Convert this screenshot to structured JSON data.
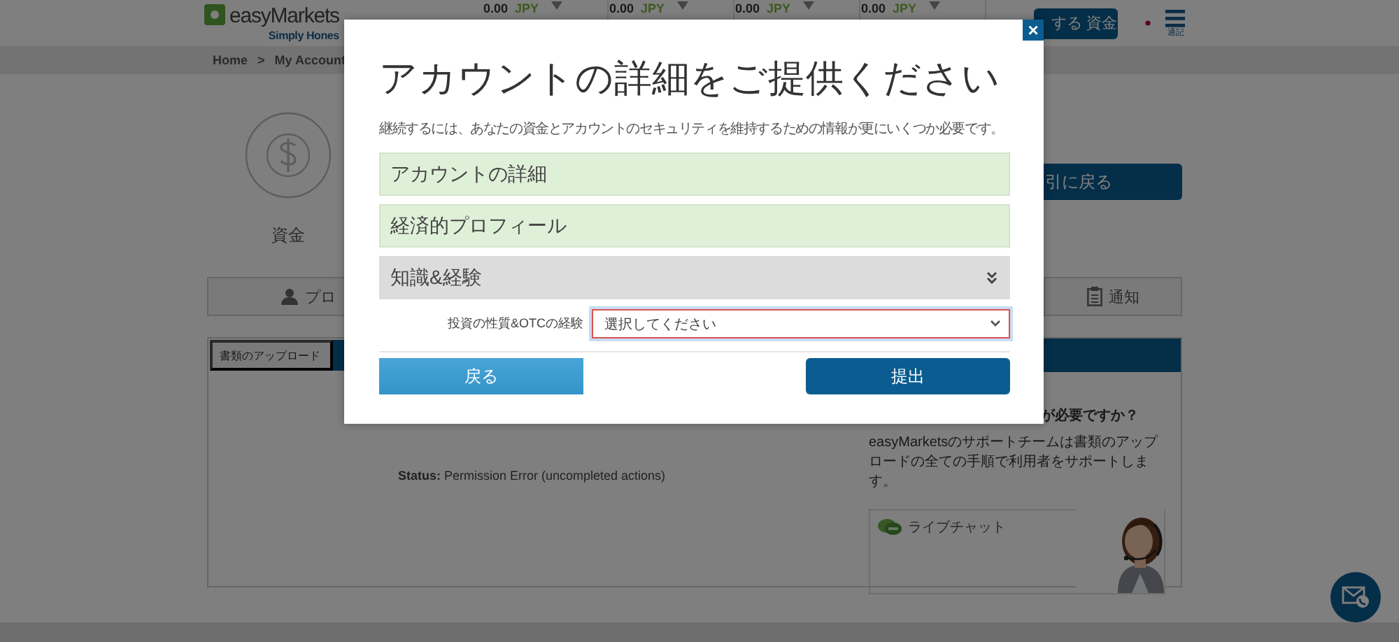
{
  "header": {
    "logo": "easyMarkets",
    "tagline": "Simply Hones",
    "tickers": [
      {
        "price": "0.00",
        "currency": "JPY"
      },
      {
        "price": "0.00",
        "currency": "JPY"
      },
      {
        "price": "0.00",
        "currency": "JPY"
      },
      {
        "price": "0.00",
        "currency": "JPY"
      }
    ],
    "deposit_button": "する 資金",
    "menu_label": "通記"
  },
  "breadcrumb": {
    "items": [
      "Home",
      "My Account"
    ],
    "separator": ">"
  },
  "funds": {
    "label": "資金"
  },
  "back_to_trading_button": "引に戻る",
  "tabs": [
    {
      "label": "プロ"
    },
    {
      "label": "通知"
    }
  ],
  "documents_panel": {
    "tab": "書類のアップロード",
    "status_label": "Status:",
    "status": "Permission Error (uncompleted actions)"
  },
  "support": {
    "heading": "が必要ですか？",
    "text": "easyMarketsのサポートチームは書類のアップロードの全ての手順で利用者をサポートします。",
    "live_chat": "ライブチャット"
  },
  "modal": {
    "close": "×",
    "title": "アカウントの詳細をご提供ください",
    "intro": "継続するには、あなたの資金とアカウントのセキュリティを維持するための情報が更にいくつか必要です。",
    "sections": [
      {
        "label": "アカウントの詳細",
        "completed": true
      },
      {
        "label": "経済的プロフィール",
        "completed": true
      },
      {
        "label": "知識&経験",
        "completed": false
      }
    ],
    "field": {
      "label": "投資の性質&OTCの経験",
      "value": "選択してください"
    },
    "buttons": [
      {
        "label": "戻る",
        "kind": "back"
      },
      {
        "label": "提出",
        "kind": "submit"
      }
    ]
  }
}
